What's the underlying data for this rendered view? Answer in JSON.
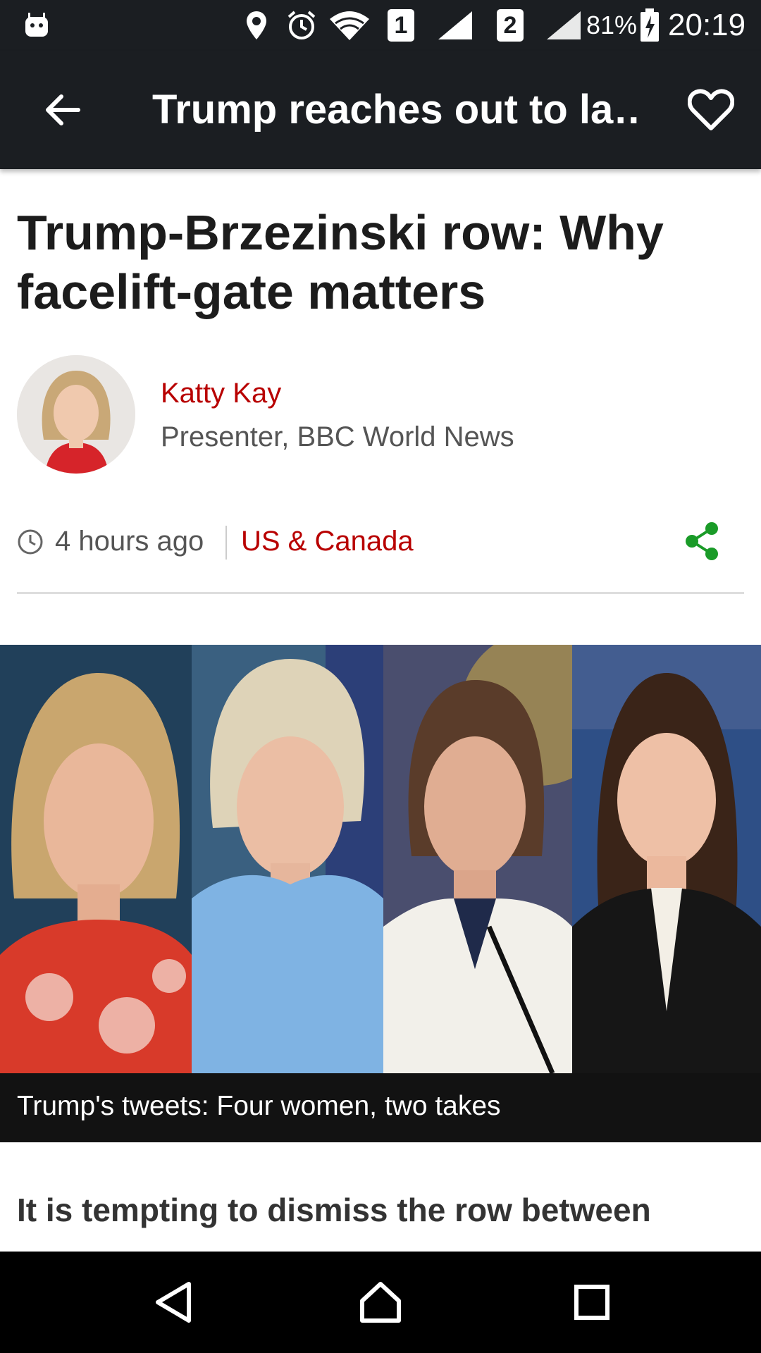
{
  "status_bar": {
    "sim1": "1",
    "sim2": "2",
    "battery": "81%",
    "time": "20:19",
    "icons": [
      "android-icon",
      "location-icon",
      "alarm-icon",
      "wifi-icon",
      "signal-icon",
      "battery-charging-icon"
    ]
  },
  "app_bar": {
    "title": "Trump reaches out to la…",
    "back_icon": "arrow-left-icon",
    "favorite_icon": "heart-outline-icon"
  },
  "article": {
    "headline": "Trump-Brzezinski row: Why facelift-gate matters",
    "author": {
      "name": "Katty Kay",
      "role": "Presenter, BBC World News"
    },
    "meta": {
      "time": "4 hours ago",
      "section": "US & Canada",
      "share_icon": "share-icon"
    },
    "image_caption": "Trump's tweets: Four women, two takes",
    "lede": "It is tempting to dismiss the row between"
  },
  "colors": {
    "bar_bg": "#1b1e22",
    "accent_red": "#b80000",
    "share_green": "#1a9b28",
    "caption_bg": "#121212"
  },
  "nav_bar": {
    "icons": [
      "back-triangle-icon",
      "home-icon",
      "recents-icon"
    ]
  }
}
